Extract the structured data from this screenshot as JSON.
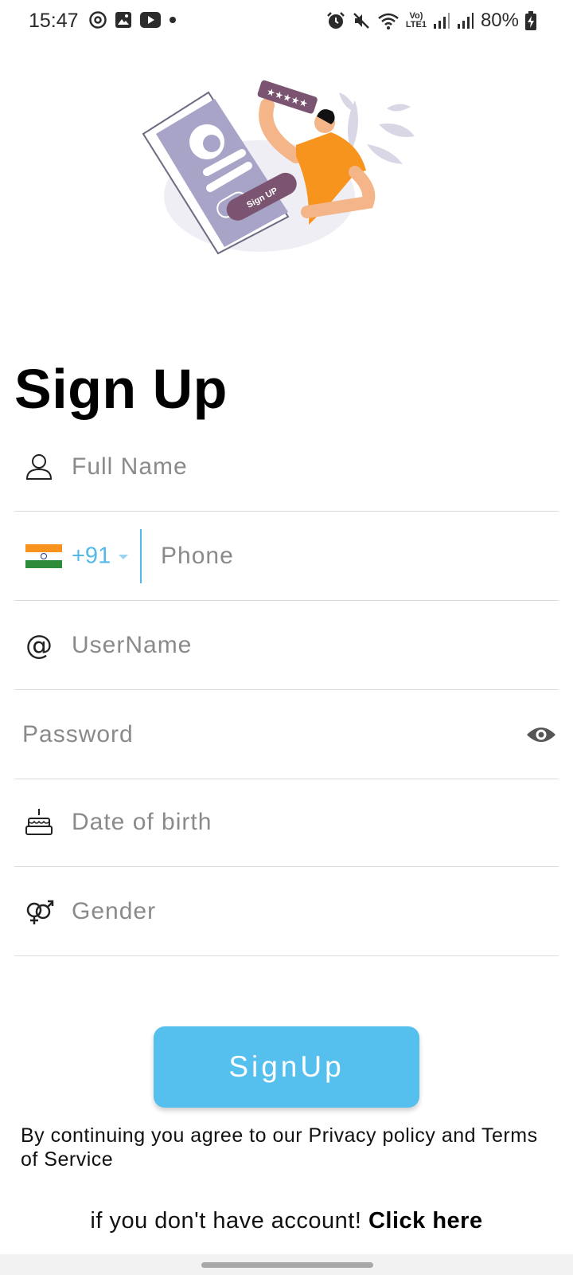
{
  "status_bar": {
    "time": "15:47",
    "battery": "80%",
    "network_label_top": "Vo)",
    "network_label_bottom": "LTE1",
    "left_icons": [
      "threads-icon",
      "gallery-icon",
      "youtube-icon",
      "notification-dot-icon"
    ],
    "right_icons": [
      "alarm-icon",
      "mute-icon",
      "wifi-icon",
      "signal-icon",
      "signal-icon",
      "battery-charging-icon"
    ]
  },
  "illustration": {
    "badge_text": "Sign UP",
    "rating_text": "★★★★★"
  },
  "page": {
    "title": "Sign Up"
  },
  "form": {
    "full_name_placeholder": "Full Name",
    "country_code": "+91",
    "phone_placeholder": "Phone",
    "username_placeholder": "UserName",
    "password_placeholder": "Password",
    "dob_placeholder": "Date of birth",
    "gender_placeholder": "Gender"
  },
  "actions": {
    "signup_label": "SignUp"
  },
  "footer": {
    "terms_text": "By continuing you agree to our Privacy policy and Terms of Service",
    "account_prompt": "if you don't have account! ",
    "click_here": "Click here"
  },
  "colors": {
    "accent": "#55c0ee",
    "country_code": "#52b9e8",
    "illustration_card": "#a8a4c8",
    "illustration_person": "#f7941d",
    "illustration_badge": "#7a5470"
  }
}
